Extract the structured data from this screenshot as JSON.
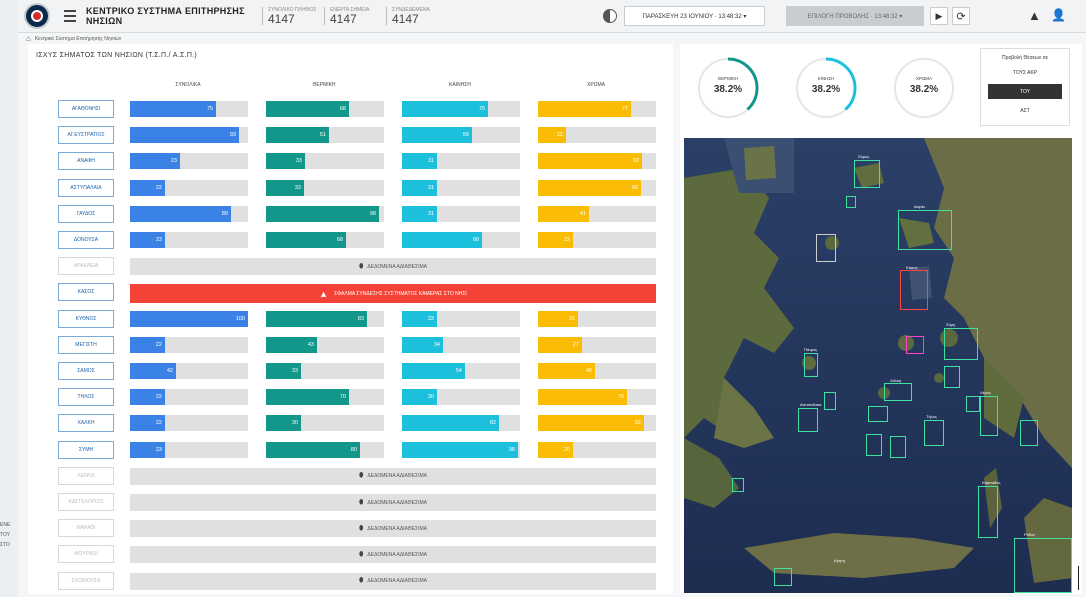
{
  "header": {
    "title": "ΚΕΝΤΡΙΚΟ ΣΥΣΤΗΜΑ ΕΠΙΤΗΡΗΣΗΣ ΝΗΣΙΩΝ",
    "counters": [
      {
        "label": "ΣΥΝΟΛΙΚΟ ΠΛΗΘΟΣ",
        "value": "4147"
      },
      {
        "label": "ΕΝΕΡΓΑ ΣΗΜΕΙΑ",
        "value": "4147"
      },
      {
        "label": "ΣΥΝΔΕΔΕΜΕΝΑ",
        "value": "4147"
      }
    ],
    "date_select": "ΠΑΡΑΣΚΕΥΗ 23 ΙΟΥΝΙΟΥ · 13:48:32  ▾",
    "view_select": "ΕΠΙΛΟΓΗ ΠΡΟΒΟΛΗΣ · 13:48:32  ▾",
    "play_icon": "▶",
    "refresh_icon": "⟳",
    "alert_icon": "▲",
    "user_icon": "👤"
  },
  "breadcrumb": {
    "home_icon": "⌂",
    "label": "Κεντρικό Σύστημα Επιτήρησης Νησιών"
  },
  "side_fragment": "ΕΝΕ ΤΟΥ ΣΤΟ",
  "panel": {
    "title": "ΙΣΧΥΣ ΣΗΜΑΤΟΣ ΤΩΝ ΝΗΣΙΩΝ (Τ.Σ.Π./ Α.Σ.Π.)",
    "columns": [
      "ΣΥΝΟΛΙΚΑ",
      "ΘΕΡΜΙΚΗ",
      "ΚΑΙΝΗΣΗ",
      "ΧΡΩΜΑ"
    ],
    "nodata_text": "ΔΕΔΟΜΕΝΑ ΑΔΙΑΘΕΣΙΜΑ",
    "alarm_text": "ΣΦΑΛΜΑ ΣΥΝΔΕΣΗΣ ΣΥΣΤΗΜΑΤΟΣ ΚΑΜΕΡΑΣ ΣΤΟ ΝΗΣΙ",
    "alarm_icon": "▲",
    "pin_icon": "⬮",
    "colors": {
      "c1": "#3b82e6",
      "c2": "#12978a",
      "c3": "#1cc0dd",
      "c4": "#fbbc05",
      "alarm": "#f44336"
    }
  },
  "rows": [
    {
      "name": "ΑΓΑΘΟΝΗΣΙ",
      "type": "data",
      "values": [
        {
          "label": "75",
          "pct": 0.73
        },
        {
          "label": "68",
          "pct": 0.7
        },
        {
          "label": "75",
          "pct": 0.73
        },
        {
          "label": "77",
          "pct": 0.79
        }
      ]
    },
    {
      "name": "ΑΓ.ΕΥΣΤΡΑΤΙΟΣ",
      "type": "data",
      "values": [
        {
          "label": "93",
          "pct": 0.92
        },
        {
          "label": "51",
          "pct": 0.53
        },
        {
          "label": "59",
          "pct": 0.59
        },
        {
          "label": "22",
          "pct": 0.24
        }
      ]
    },
    {
      "name": "ΑΝΑΦΗ",
      "type": "data",
      "values": [
        {
          "label": "23",
          "pct": 0.42
        },
        {
          "label": "33",
          "pct": 0.33
        },
        {
          "label": "31",
          "pct": 0.3
        },
        {
          "label": "92",
          "pct": 0.88
        }
      ]
    },
    {
      "name": "ΑΣΤΥΠΑΛΑΙΑ",
      "type": "data",
      "values": [
        {
          "label": "22",
          "pct": 0.3
        },
        {
          "label": "33",
          "pct": 0.32
        },
        {
          "label": "31",
          "pct": 0.3
        },
        {
          "label": "92",
          "pct": 0.87
        }
      ]
    },
    {
      "name": "ΓΑΥΔΟΣ",
      "type": "data",
      "values": [
        {
          "label": "89",
          "pct": 0.86
        },
        {
          "label": "98",
          "pct": 0.96
        },
        {
          "label": "31",
          "pct": 0.3
        },
        {
          "label": "41",
          "pct": 0.43
        }
      ]
    },
    {
      "name": "ΔΟΝΟΥΣΑ",
      "type": "data",
      "values": [
        {
          "label": "23",
          "pct": 0.3
        },
        {
          "label": "68",
          "pct": 0.68
        },
        {
          "label": "68",
          "pct": 0.68
        },
        {
          "label": "22",
          "pct": 0.3
        }
      ]
    },
    {
      "name": "ΗΡΑΚΛΕΙΑ",
      "type": "nodata"
    },
    {
      "name": "ΚΑΣΟΣ",
      "type": "alarm"
    },
    {
      "name": "ΚΥΘΝΟΣ",
      "type": "data",
      "values": [
        {
          "label": "100",
          "pct": 1.0
        },
        {
          "label": "83",
          "pct": 0.86
        },
        {
          "label": "33",
          "pct": 0.3
        },
        {
          "label": "31",
          "pct": 0.34
        }
      ]
    },
    {
      "name": "ΜΕΓΙΣΤΗ",
      "type": "data",
      "values": [
        {
          "label": "22",
          "pct": 0.3
        },
        {
          "label": "43",
          "pct": 0.43
        },
        {
          "label": "34",
          "pct": 0.35
        },
        {
          "label": "27",
          "pct": 0.37
        }
      ]
    },
    {
      "name": "ΣΑΜΟΣ",
      "type": "data",
      "values": [
        {
          "label": "42",
          "pct": 0.39
        },
        {
          "label": "33",
          "pct": 0.3
        },
        {
          "label": "54",
          "pct": 0.53
        },
        {
          "label": "48",
          "pct": 0.48
        }
      ]
    },
    {
      "name": "ΤΗΛΟΣ",
      "type": "data",
      "values": [
        {
          "label": "22",
          "pct": 0.3
        },
        {
          "label": "70",
          "pct": 0.7
        },
        {
          "label": "30",
          "pct": 0.3
        },
        {
          "label": "79",
          "pct": 0.75
        }
      ]
    },
    {
      "name": "ΧΑΛΚΗ",
      "type": "data",
      "values": [
        {
          "label": "22",
          "pct": 0.3
        },
        {
          "label": "30",
          "pct": 0.3
        },
        {
          "label": "82",
          "pct": 0.82
        },
        {
          "label": "92",
          "pct": 0.9
        }
      ]
    },
    {
      "name": "ΣΥΜΗ",
      "type": "data",
      "values": [
        {
          "label": "23",
          "pct": 0.3
        },
        {
          "label": "80",
          "pct": 0.8
        },
        {
          "label": "98",
          "pct": 0.98
        },
        {
          "label": "20",
          "pct": 0.3
        }
      ]
    },
    {
      "name": "ΛΕΙΨΟΙ",
      "type": "nodata"
    },
    {
      "name": "ΚΑΣΤΕΛΟΡΙΖΟ",
      "type": "nodata"
    },
    {
      "name": "ΜΑΡΑΘΙ",
      "type": "nodata"
    },
    {
      "name": "ΦΟΥΡΝΟΙ",
      "type": "nodata"
    },
    {
      "name": "ΣΧΟΙΝΟΥΣΑ",
      "type": "nodata"
    }
  ],
  "gauges": [
    {
      "label": "ΘΕΡΜΙΚΗ",
      "value": "38.2%",
      "fraction": 0.382,
      "color": "#12978a"
    },
    {
      "label": "ΚΙΝΗΣΗ",
      "value": "38.2%",
      "fraction": 0.382,
      "color": "#1cc0dd"
    },
    {
      "label": "ΧΡΩΜΑ",
      "value": "38.2%",
      "fraction": 0.0,
      "color": "#fbbc05"
    }
  ],
  "position_box": {
    "title": "Προβολή Θέσεων σε",
    "options": [
      "ΤΟΥΣ ΑΚΡ",
      "ΤΟΥ",
      "ΑΣΤ"
    ],
    "active_index": 1
  },
  "map_labels": [
    {
      "text": "Σάμος"
    },
    {
      "text": "Ικαρία"
    },
    {
      "text": "Κάσος"
    },
    {
      "text": "Κάρπαθος"
    },
    {
      "text": "Κρήτη"
    },
    {
      "text": "Ρόδος"
    },
    {
      "text": "Σύμη"
    },
    {
      "text": "Τήλος"
    },
    {
      "text": "Χάλκη"
    },
    {
      "text": "Αστυπάλαια"
    },
    {
      "text": "Λέρος"
    },
    {
      "text": "Πάτμος"
    }
  ]
}
